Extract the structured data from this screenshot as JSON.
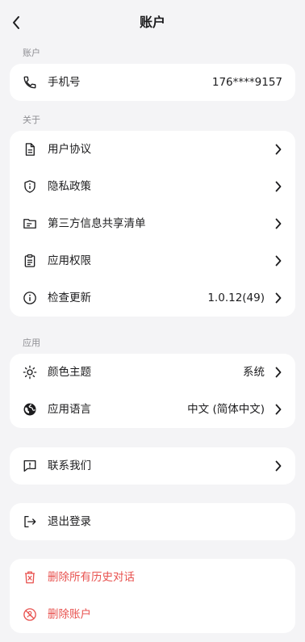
{
  "header": {
    "title": "账户"
  },
  "sections": {
    "account": "账户",
    "about": "关于",
    "app": "应用"
  },
  "account": {
    "phone_label": "手机号",
    "phone_value": "176****9157"
  },
  "about": {
    "items": [
      {
        "label": "用户协议",
        "icon": "document-icon"
      },
      {
        "label": "隐私政策",
        "icon": "shield-info-icon"
      },
      {
        "label": "第三方信息共享清单",
        "icon": "folder-list-icon"
      },
      {
        "label": "应用权限",
        "icon": "clipboard-icon"
      },
      {
        "label": "检查更新",
        "value": "1.0.12(49)",
        "icon": "info-icon"
      }
    ]
  },
  "app": {
    "theme_label": "颜色主题",
    "theme_value": "系统",
    "language_label": "应用语言",
    "language_value": "中文 (简体中文)"
  },
  "contact": {
    "label": "联系我们"
  },
  "logout": {
    "label": "退出登录"
  },
  "danger": {
    "delete_history_label": "删除所有历史对话",
    "delete_account_label": "删除账户"
  },
  "colors": {
    "danger": "#e8524f",
    "background": "#f4f4f6",
    "card": "#ffffff"
  }
}
